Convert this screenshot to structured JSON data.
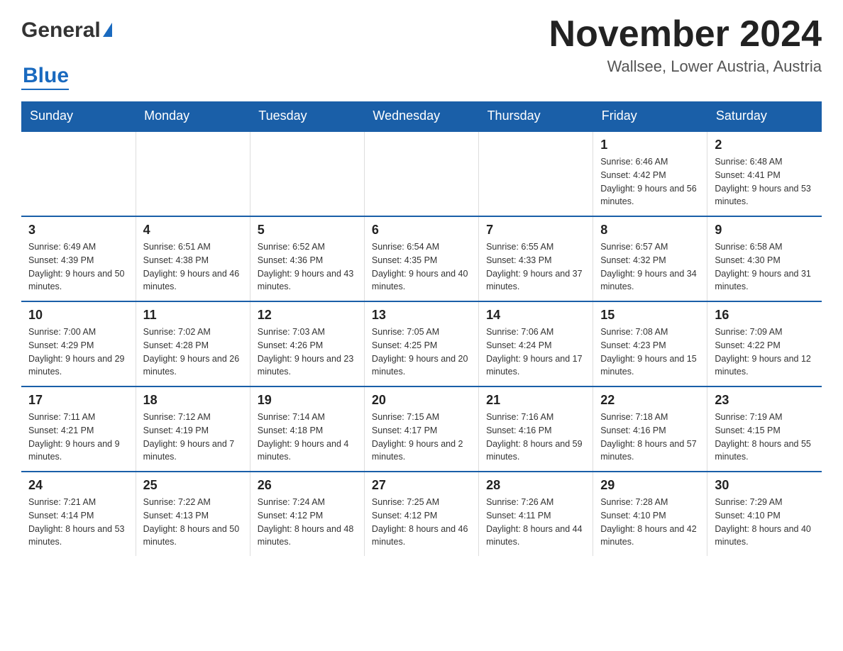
{
  "header": {
    "logo_general": "General",
    "logo_blue": "Blue",
    "title": "November 2024",
    "subtitle": "Wallsee, Lower Austria, Austria"
  },
  "weekdays": [
    "Sunday",
    "Monday",
    "Tuesday",
    "Wednesday",
    "Thursday",
    "Friday",
    "Saturday"
  ],
  "weeks": [
    [
      {
        "day": "",
        "info": ""
      },
      {
        "day": "",
        "info": ""
      },
      {
        "day": "",
        "info": ""
      },
      {
        "day": "",
        "info": ""
      },
      {
        "day": "",
        "info": ""
      },
      {
        "day": "1",
        "info": "Sunrise: 6:46 AM\nSunset: 4:42 PM\nDaylight: 9 hours and 56 minutes."
      },
      {
        "day": "2",
        "info": "Sunrise: 6:48 AM\nSunset: 4:41 PM\nDaylight: 9 hours and 53 minutes."
      }
    ],
    [
      {
        "day": "3",
        "info": "Sunrise: 6:49 AM\nSunset: 4:39 PM\nDaylight: 9 hours and 50 minutes."
      },
      {
        "day": "4",
        "info": "Sunrise: 6:51 AM\nSunset: 4:38 PM\nDaylight: 9 hours and 46 minutes."
      },
      {
        "day": "5",
        "info": "Sunrise: 6:52 AM\nSunset: 4:36 PM\nDaylight: 9 hours and 43 minutes."
      },
      {
        "day": "6",
        "info": "Sunrise: 6:54 AM\nSunset: 4:35 PM\nDaylight: 9 hours and 40 minutes."
      },
      {
        "day": "7",
        "info": "Sunrise: 6:55 AM\nSunset: 4:33 PM\nDaylight: 9 hours and 37 minutes."
      },
      {
        "day": "8",
        "info": "Sunrise: 6:57 AM\nSunset: 4:32 PM\nDaylight: 9 hours and 34 minutes."
      },
      {
        "day": "9",
        "info": "Sunrise: 6:58 AM\nSunset: 4:30 PM\nDaylight: 9 hours and 31 minutes."
      }
    ],
    [
      {
        "day": "10",
        "info": "Sunrise: 7:00 AM\nSunset: 4:29 PM\nDaylight: 9 hours and 29 minutes."
      },
      {
        "day": "11",
        "info": "Sunrise: 7:02 AM\nSunset: 4:28 PM\nDaylight: 9 hours and 26 minutes."
      },
      {
        "day": "12",
        "info": "Sunrise: 7:03 AM\nSunset: 4:26 PM\nDaylight: 9 hours and 23 minutes."
      },
      {
        "day": "13",
        "info": "Sunrise: 7:05 AM\nSunset: 4:25 PM\nDaylight: 9 hours and 20 minutes."
      },
      {
        "day": "14",
        "info": "Sunrise: 7:06 AM\nSunset: 4:24 PM\nDaylight: 9 hours and 17 minutes."
      },
      {
        "day": "15",
        "info": "Sunrise: 7:08 AM\nSunset: 4:23 PM\nDaylight: 9 hours and 15 minutes."
      },
      {
        "day": "16",
        "info": "Sunrise: 7:09 AM\nSunset: 4:22 PM\nDaylight: 9 hours and 12 minutes."
      }
    ],
    [
      {
        "day": "17",
        "info": "Sunrise: 7:11 AM\nSunset: 4:21 PM\nDaylight: 9 hours and 9 minutes."
      },
      {
        "day": "18",
        "info": "Sunrise: 7:12 AM\nSunset: 4:19 PM\nDaylight: 9 hours and 7 minutes."
      },
      {
        "day": "19",
        "info": "Sunrise: 7:14 AM\nSunset: 4:18 PM\nDaylight: 9 hours and 4 minutes."
      },
      {
        "day": "20",
        "info": "Sunrise: 7:15 AM\nSunset: 4:17 PM\nDaylight: 9 hours and 2 minutes."
      },
      {
        "day": "21",
        "info": "Sunrise: 7:16 AM\nSunset: 4:16 PM\nDaylight: 8 hours and 59 minutes."
      },
      {
        "day": "22",
        "info": "Sunrise: 7:18 AM\nSunset: 4:16 PM\nDaylight: 8 hours and 57 minutes."
      },
      {
        "day": "23",
        "info": "Sunrise: 7:19 AM\nSunset: 4:15 PM\nDaylight: 8 hours and 55 minutes."
      }
    ],
    [
      {
        "day": "24",
        "info": "Sunrise: 7:21 AM\nSunset: 4:14 PM\nDaylight: 8 hours and 53 minutes."
      },
      {
        "day": "25",
        "info": "Sunrise: 7:22 AM\nSunset: 4:13 PM\nDaylight: 8 hours and 50 minutes."
      },
      {
        "day": "26",
        "info": "Sunrise: 7:24 AM\nSunset: 4:12 PM\nDaylight: 8 hours and 48 minutes."
      },
      {
        "day": "27",
        "info": "Sunrise: 7:25 AM\nSunset: 4:12 PM\nDaylight: 8 hours and 46 minutes."
      },
      {
        "day": "28",
        "info": "Sunrise: 7:26 AM\nSunset: 4:11 PM\nDaylight: 8 hours and 44 minutes."
      },
      {
        "day": "29",
        "info": "Sunrise: 7:28 AM\nSunset: 4:10 PM\nDaylight: 8 hours and 42 minutes."
      },
      {
        "day": "30",
        "info": "Sunrise: 7:29 AM\nSunset: 4:10 PM\nDaylight: 8 hours and 40 minutes."
      }
    ]
  ]
}
